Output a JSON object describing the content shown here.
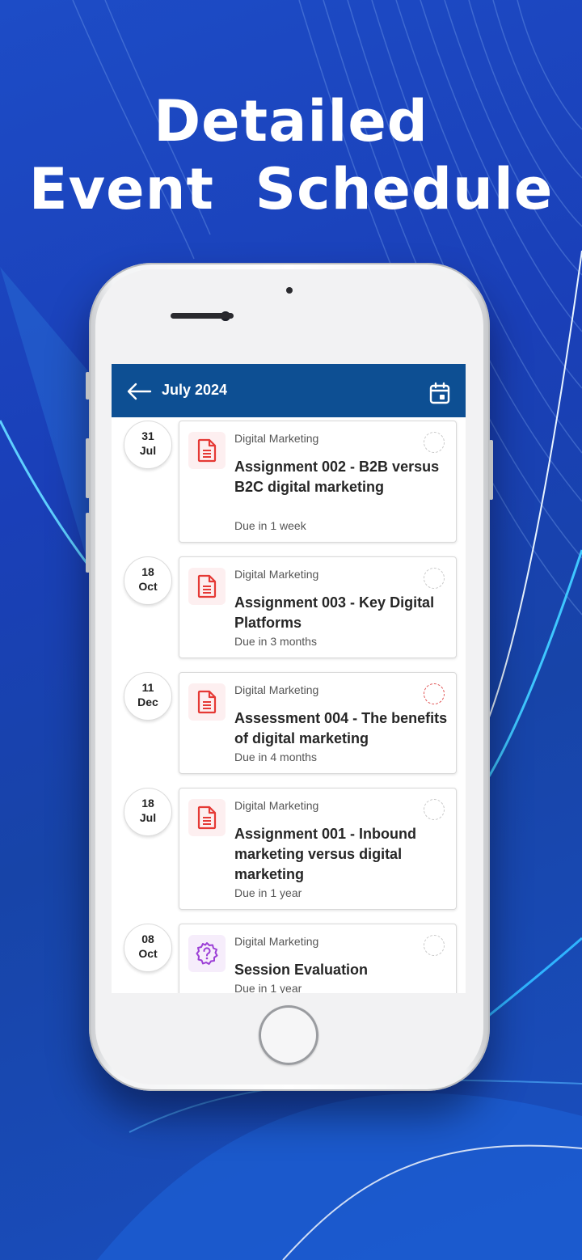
{
  "promo": {
    "headline_line1": "Detailed",
    "headline_line2": "Event  Schedule"
  },
  "appbar": {
    "back_icon": "arrow-left-icon",
    "title": "July 2024",
    "calendar_icon": "calendar-icon"
  },
  "events": [
    {
      "day": "31",
      "month": "Jul",
      "category": "Digital Marketing",
      "title": "Assignment 002 - B2B versus B2C digital marketing",
      "due": "Due in 1 week",
      "icon": "document-icon",
      "status_color": "#c8c8c8"
    },
    {
      "day": "18",
      "month": "Oct",
      "category": "Digital Marketing",
      "title": "Assignment 003 - Key Digital Platforms",
      "due": "Due in 3 months",
      "icon": "document-icon",
      "status_color": "#c8c8c8"
    },
    {
      "day": "11",
      "month": "Dec",
      "category": "Digital Marketing",
      "title": "Assessment 004 - The benefits of digital marketing",
      "due": "Due in 4 months",
      "icon": "document-icon",
      "status_color": "#e05050"
    },
    {
      "day": "18",
      "month": "Jul",
      "category": "Digital Marketing",
      "title": "Assignment 001 - Inbound marketing versus digital marketing",
      "due": "Due in 1 year",
      "icon": "document-icon",
      "status_color": "#c8c8c8"
    },
    {
      "day": "08",
      "month": "Oct",
      "category": "Digital Marketing",
      "title": "Session Evaluation",
      "due": "Due in 1 year",
      "icon": "feedback-question-icon",
      "status_color": "#c8c8c8"
    }
  ],
  "colors": {
    "appbar": "#0d4f93",
    "document_icon": "#e53935",
    "evaluation_icon": "#9c3fd6"
  }
}
